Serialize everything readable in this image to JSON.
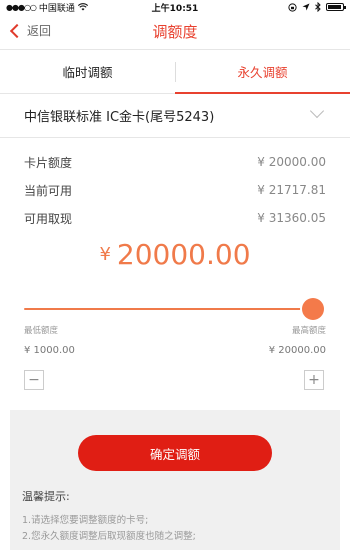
{
  "status_bar": {
    "signal": "●●●○○",
    "carrier": "中国联通",
    "wifi_icon": "wifi-icon",
    "time": "上午10:51",
    "right_icons": [
      "lock-rotation-icon",
      "location-icon",
      "bluetooth-icon",
      "battery-icon"
    ]
  },
  "nav": {
    "back_label": "返回",
    "title": "调额度"
  },
  "tabs": [
    {
      "label": "临时调额",
      "active": false
    },
    {
      "label": "永久调额",
      "active": true
    }
  ],
  "card": {
    "name": "中信银联标准  IC金卡(尾号5243)"
  },
  "info": [
    {
      "label": "卡片额度",
      "value": "¥  20000.00"
    },
    {
      "label": "当前可用",
      "value": "¥  21717.81"
    },
    {
      "label": "可用取现",
      "value": "¥  31360.05"
    }
  ],
  "amount": {
    "currency": "¥",
    "value": "20000.00"
  },
  "slider": {
    "min_label": "最低额度",
    "max_label": "最高额度",
    "min_value": "¥  1000.00",
    "max_value": "¥  20000.00",
    "level": 1.0
  },
  "stepper": {
    "minus": "−",
    "plus": "+"
  },
  "confirm": {
    "label": "确定调额"
  },
  "tips": {
    "title": "温馨提示:",
    "lines": [
      "1.请选择您要调整额度的卡号;",
      "2.您永久额度调整后取现额度也随之调整;"
    ]
  },
  "colors": {
    "accent": "#e8412f",
    "button": "#e01e14",
    "amount": "#f07a4a"
  }
}
